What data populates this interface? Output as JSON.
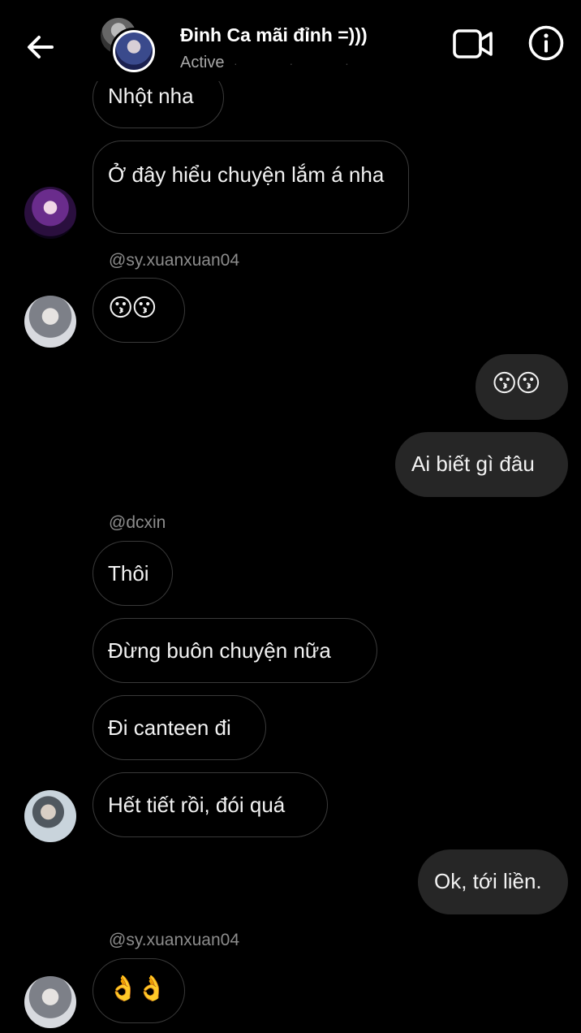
{
  "header": {
    "title": "Đinh Ca mãi đỉnh =)))",
    "status": "Active",
    "back_icon": "arrow-left-icon",
    "video_icon": "video-camera-icon",
    "info_icon": "info-icon"
  },
  "messages": [
    {
      "text": "Nhột nha"
    },
    {
      "text": "Ở đây hiểu chuyện lắm á nha"
    },
    {
      "sender": "@sy.xuanxuan04"
    },
    {
      "text": "😗😗"
    },
    {
      "text": "😗😗"
    },
    {
      "text": "Ai biết gì đâu"
    },
    {
      "sender": "@dcxin"
    },
    {
      "text": "Thôi"
    },
    {
      "text": "Đừng buôn chuyện nữa"
    },
    {
      "text": "Đi canteen đi"
    },
    {
      "text": "Hết tiết rồi, đói quá"
    },
    {
      "text": "Ok, tới liền."
    },
    {
      "sender": "@sy.xuanxuan04"
    },
    {
      "text": "👌👌"
    }
  ],
  "colors": {
    "background": "#000000",
    "incoming_border": "#3a3a3a",
    "outgoing_bg": "#262626",
    "sender_text": "#8c8c8c"
  }
}
